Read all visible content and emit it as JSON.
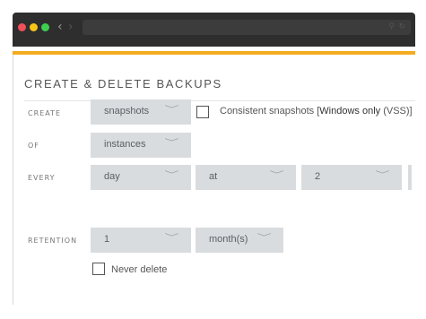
{
  "browser": {
    "back_glyph": "‹",
    "forward_glyph": "›"
  },
  "panel": {
    "title": "CREATE & DELETE BACKUPS"
  },
  "rows": {
    "create": {
      "label": "CREATE",
      "select_value": "snapshots",
      "checkbox_label_prefix": "Consistent snapshots [",
      "checkbox_label_highlight": "Windows only",
      "checkbox_label_suffix": " (VSS)]",
      "checkbox_checked": false
    },
    "of": {
      "label": "OF",
      "select_value": "instances"
    },
    "every": {
      "label": "EVERY",
      "period_value": "day",
      "at_value": "at",
      "hour_value": "2"
    },
    "retention": {
      "label": "RETENTION",
      "count_value": "1",
      "unit_value": "month(s)",
      "never_delete_label": "Never delete",
      "never_delete_checked": false
    }
  },
  "icons": {
    "chevron": "﹀",
    "search": "⚲",
    "refresh": "↻"
  },
  "colors": {
    "accent": "#f3ab1f",
    "titlebar": "#2e2e2e",
    "select_bg": "#d9dcdf"
  }
}
